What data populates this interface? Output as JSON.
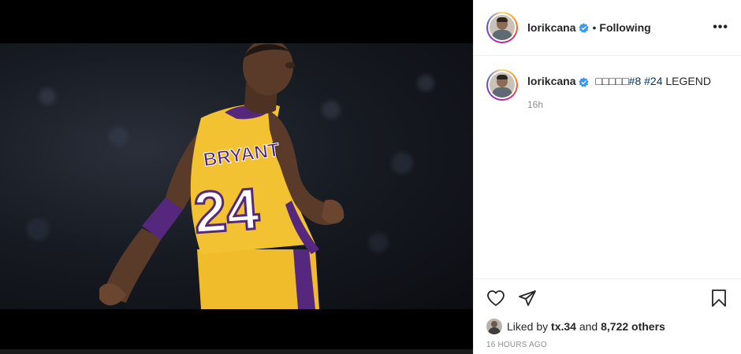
{
  "header": {
    "username": "lorikcana",
    "verified": true,
    "separator": "•",
    "follow_state": "Following",
    "more_icon": "more-horizontal-icon"
  },
  "caption": {
    "username": "lorikcana",
    "prefix": "□□□□□",
    "hashtag1": "#8",
    "hashtag2": "#24",
    "suffix": "LEGEND",
    "time": "16h"
  },
  "actions": {
    "like_icon": "heart-icon",
    "share_icon": "paper-plane-icon",
    "save_icon": "bookmark-icon"
  },
  "likes": {
    "prefix": "Liked by",
    "user": "tx.34",
    "and": "and",
    "count": "8,722 others"
  },
  "timestamp": "16 HOURS AGO",
  "colors": {
    "text": "#262626",
    "muted": "#8e8e8e",
    "hashtag": "#00376b",
    "verified": "#3897f0",
    "jersey_yellow": "#f2c232",
    "jersey_purple": "#55287e"
  }
}
